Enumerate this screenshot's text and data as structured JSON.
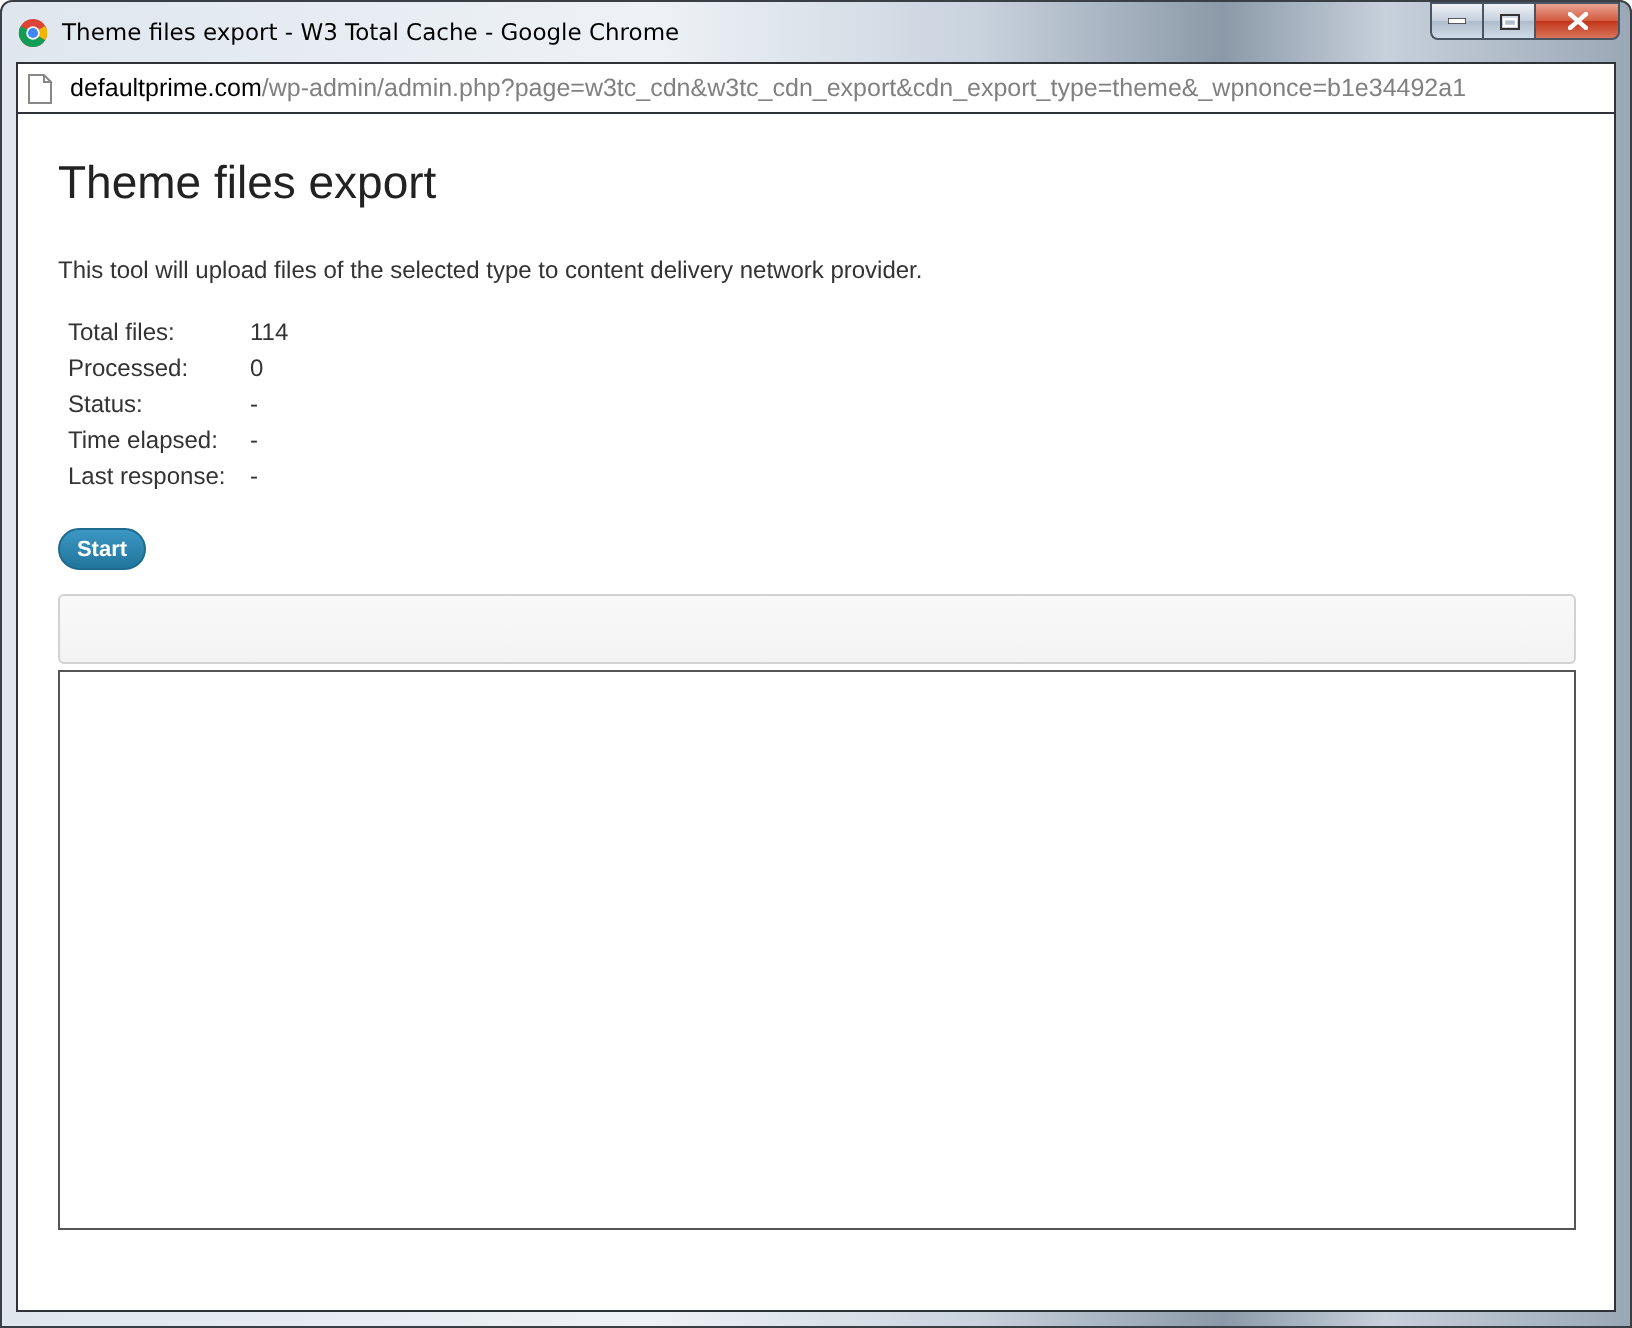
{
  "window": {
    "title": "Theme files export - W3 Total Cache - Google Chrome"
  },
  "address_bar": {
    "host": "defaultprime.com",
    "path": "/wp-admin/admin.php?page=w3tc_cdn&w3tc_cdn_export&cdn_export_type=theme&_wpnonce=b1e34492a1"
  },
  "page": {
    "heading": "Theme files export",
    "description": "This tool will upload files of the selected type to content delivery network provider.",
    "stats": [
      {
        "label": "Total files:",
        "value": "114"
      },
      {
        "label": "Processed:",
        "value": "0"
      },
      {
        "label": "Status:",
        "value": "-"
      },
      {
        "label": "Time elapsed:",
        "value": "-"
      },
      {
        "label": "Last response:",
        "value": "-"
      }
    ],
    "start_button": "Start"
  }
}
